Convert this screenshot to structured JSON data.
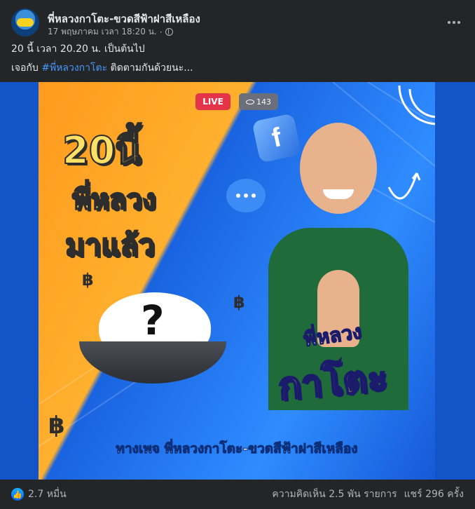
{
  "header": {
    "page_name": "พี่หลวงกาโตะ-ขวดสีฟ้าฝาสีเหลือง",
    "timestamp": "17 พฤษภาคม เวลา 18:20 น.",
    "separator": "·",
    "privacy_icon": "globe-icon",
    "more_icon": "more-options-icon"
  },
  "post_text": {
    "line1": "20 นี้ เวลา 20.20 น. เป็นต้นไป",
    "line2_prefix": "เจอกับ ",
    "hashtag": "#พี่หลวงกาโตะ",
    "line2_suffix": " ติดตามกันด้วยนะ..."
  },
  "image": {
    "live_badge": "LIVE",
    "viewer_count": "143",
    "headline_1": "20นี้",
    "headline_2": "พี่หลวง",
    "headline_3": "มาแล้ว",
    "question_mark": "?",
    "brand_line1": "พี่หลวง",
    "brand_line2": "กาโตะ",
    "caption": "ทางเพจ พี่หลวงกาโตะ-ขวดสีฟ้าฝาสีเหลือง",
    "baht_symbol": "฿",
    "fb_letter": "f"
  },
  "footer": {
    "reactions_count": "2.7 หมื่น",
    "comments": "ความคิดเห็น 2.5 พัน รายการ",
    "shares": "แชร์ 296 ครั้ง"
  },
  "colors": {
    "background": "#242526",
    "text_primary": "#e4e6eb",
    "text_secondary": "#b0b3b8",
    "hashtag": "#4599ff",
    "live_red": "#e4344a",
    "headline_yellow": "#ffe066"
  }
}
